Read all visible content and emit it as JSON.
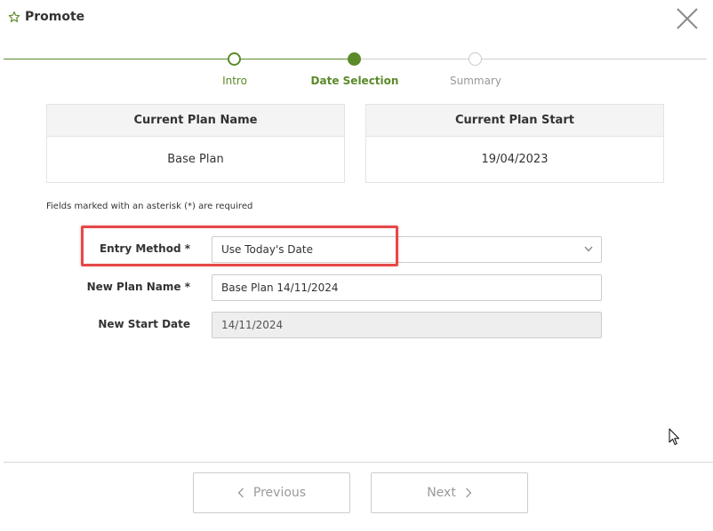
{
  "dialog": {
    "title": "Promote",
    "icon": "star-outline-icon",
    "accent_color": "#5b8a2a"
  },
  "stepper": {
    "steps": [
      {
        "label": "Intro",
        "state": "completed"
      },
      {
        "label": "Date Selection",
        "state": "active"
      },
      {
        "label": "Summary",
        "state": "pending"
      }
    ]
  },
  "cards": [
    {
      "header": "Current Plan Name",
      "value": "Base Plan"
    },
    {
      "header": "Current Plan Start",
      "value": "19/04/2023"
    }
  ],
  "form": {
    "required_note": "Fields marked with an asterisk (*) are required",
    "entry_method": {
      "label": "Entry Method *",
      "value": "Use Today's Date"
    },
    "new_plan_name": {
      "label": "New Plan Name *",
      "value": "Base Plan 14/11/2024"
    },
    "new_start_date": {
      "label": "New Start Date",
      "value": "14/11/2024"
    }
  },
  "footer": {
    "previous_label": "Previous",
    "next_label": "Next"
  },
  "annotation": {
    "highlight_color": "#e54848"
  }
}
